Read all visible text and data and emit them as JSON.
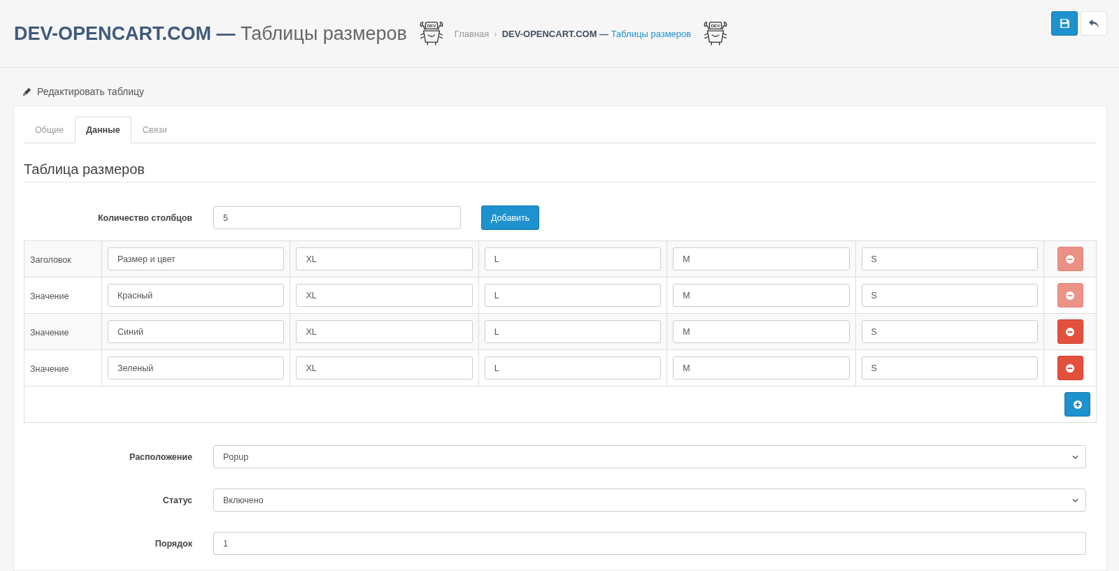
{
  "header": {
    "title": "**DEV-OPENCART.COM —** Таблицы размеров",
    "title_logo": {
      "text": "DEV"
    },
    "breadcrumb": [
      {
        "label": "Главная"
      },
      {
        "separator": "›",
        "label": "**DEV-OPENCART.COM —** Таблицы размеров"
      }
    ],
    "breadcrumb_logo": {
      "text": "DEV"
    },
    "actions": [
      {
        "kind": "save"
      },
      {
        "kind": "back"
      }
    ]
  },
  "panel": {
    "title": "Редактировать таблицу",
    "tabs": [
      {
        "label": "Общие",
        "selected": false
      },
      {
        "label": "Данные",
        "selected": true
      },
      {
        "label": "Связи",
        "selected": false
      }
    ],
    "section_title": "Таблица размеров",
    "column_count": {
      "label": "Количество столбцов",
      "value": "5",
      "button": "Добавить"
    },
    "size_table": {
      "rows": [
        {
          "label": "Заголовок",
          "cells": [
            "Размер и цвет",
            "XL",
            "L",
            "M",
            "S"
          ],
          "remove": {
            "disabled": true
          }
        },
        {
          "label": "Значение",
          "cells": [
            "Красный",
            "XL",
            "L",
            "M",
            "S"
          ],
          "remove": {
            "disabled": true
          }
        },
        {
          "label": "Значение",
          "cells": [
            "Синий",
            "XL",
            "L",
            "M",
            "S"
          ],
          "remove": {
            "disabled": false
          }
        },
        {
          "label": "Значение",
          "cells": [
            "Зеленый",
            "XL",
            "L",
            "M",
            "S"
          ],
          "remove": {
            "disabled": false
          }
        }
      ]
    },
    "fields": [
      {
        "kind": "select",
        "label": "Расположение",
        "value": "Popup"
      },
      {
        "kind": "select",
        "label": "Статус",
        "value": "Включено"
      },
      {
        "kind": "input",
        "label": "Порядок",
        "value": "1"
      }
    ]
  }
}
